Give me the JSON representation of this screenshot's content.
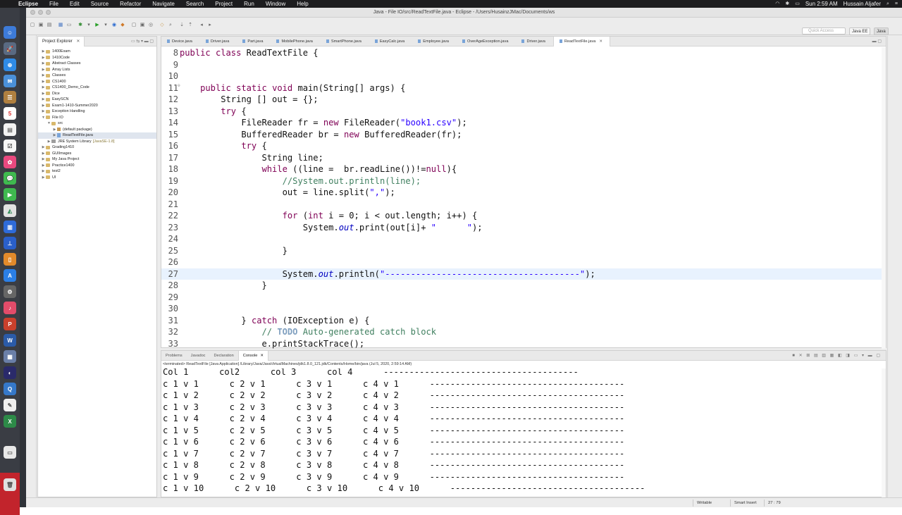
{
  "menubar": {
    "app": "Eclipse",
    "items": [
      "File",
      "Edit",
      "Source",
      "Refactor",
      "Navigate",
      "Search",
      "Project",
      "Run",
      "Window",
      "Help"
    ],
    "clock": "Sun 2:59 AM",
    "user": "Hussain Aljafer"
  },
  "window": {
    "title": "Java - File IO/src/ReadTextFile.java - Eclipse - /Users/HusainzJMac/Documents/ws",
    "quick_access": "Quick Access",
    "perspectives": [
      "Java EE",
      "Java"
    ]
  },
  "explorer": {
    "tab": "Project Explorer",
    "items": [
      {
        "label": "1400Exam",
        "depth": 0,
        "arrow": "▶",
        "kind": "folder"
      },
      {
        "label": "1410Code",
        "depth": 0,
        "arrow": "▶",
        "kind": "folder"
      },
      {
        "label": "Abstract Classes",
        "depth": 0,
        "arrow": "▶",
        "kind": "folder"
      },
      {
        "label": "Array Lists",
        "depth": 0,
        "arrow": "▶",
        "kind": "folder"
      },
      {
        "label": "Classes",
        "depth": 0,
        "arrow": "▶",
        "kind": "folder"
      },
      {
        "label": "CS1400",
        "depth": 0,
        "arrow": "▶",
        "kind": "folder"
      },
      {
        "label": "CS1400_Demo_Code",
        "depth": 0,
        "arrow": "▶",
        "kind": "folder"
      },
      {
        "label": "Dice",
        "depth": 0,
        "arrow": "▶",
        "kind": "folder"
      },
      {
        "label": "EasySCN",
        "depth": 0,
        "arrow": "▶",
        "kind": "folder"
      },
      {
        "label": "Exam1-1410-Summer2020",
        "depth": 0,
        "arrow": "▶",
        "kind": "folder"
      },
      {
        "label": "Exception Handling",
        "depth": 0,
        "arrow": "▶",
        "kind": "folder"
      },
      {
        "label": "File IO",
        "depth": 0,
        "arrow": "▼",
        "kind": "folder"
      },
      {
        "label": "src",
        "depth": 1,
        "arrow": "▼",
        "kind": "folder"
      },
      {
        "label": "(default package)",
        "depth": 2,
        "arrow": "▶",
        "kind": "package"
      },
      {
        "label": "ReadTextFile.java",
        "depth": 2,
        "arrow": "▶",
        "kind": "file",
        "selected": true
      },
      {
        "label": "JRE System Library",
        "depth": 1,
        "arrow": "▶",
        "kind": "library",
        "suffix": "[JavaSE-1.8]"
      },
      {
        "label": "Grading1410",
        "depth": 0,
        "arrow": "▶",
        "kind": "folder"
      },
      {
        "label": "GUIImages",
        "depth": 0,
        "arrow": "▶",
        "kind": "folder"
      },
      {
        "label": "My Java Project",
        "depth": 0,
        "arrow": "▶",
        "kind": "folder"
      },
      {
        "label": "Practice1400",
        "depth": 0,
        "arrow": "▶",
        "kind": "folder"
      },
      {
        "label": "test2",
        "depth": 0,
        "arrow": "▶",
        "kind": "folder"
      },
      {
        "label": "UI",
        "depth": 0,
        "arrow": "▶",
        "kind": "folder"
      }
    ]
  },
  "editor": {
    "tabs": [
      "Device.java",
      "Driver.java",
      "Part.java",
      "MobilePhone.java",
      "SmartPhone.java",
      "EasyCalc.java",
      "Employee.java",
      "OverAgeException.java",
      "Driver.java",
      "ReadTextFile.java"
    ],
    "active_tab": 9,
    "lines": [
      {
        "num": "8",
        "text": "public class ReadTextFile {"
      },
      {
        "num": "9",
        "text": ""
      },
      {
        "num": "10",
        "text": ""
      },
      {
        "num": "11",
        "text": "    public static void main(String[] args) {",
        "fold": true
      },
      {
        "num": "12",
        "text": "        String [] out = {};"
      },
      {
        "num": "13",
        "text": "        try {"
      },
      {
        "num": "14",
        "text": "            FileReader fr = new FileReader(\"book1.csv\");"
      },
      {
        "num": "15",
        "text": "            BufferedReader br = new BufferedReader(fr);"
      },
      {
        "num": "16",
        "text": "            try {"
      },
      {
        "num": "17",
        "text": "                String line;"
      },
      {
        "num": "18",
        "text": "                while ((line =  br.readLine())!=null){"
      },
      {
        "num": "19",
        "text": "                    //System.out.println(line);"
      },
      {
        "num": "20",
        "text": "                    out = line.split(\",\");"
      },
      {
        "num": "21",
        "text": ""
      },
      {
        "num": "22",
        "text": "                    for (int i = 0; i < out.length; i++) {"
      },
      {
        "num": "23",
        "text": "                        System.out.print(out[i]+ \"      \");"
      },
      {
        "num": "24",
        "text": ""
      },
      {
        "num": "25",
        "text": "                    }"
      },
      {
        "num": "26",
        "text": ""
      },
      {
        "num": "27",
        "text": "                    System.out.println(\"--------------------------------------\");",
        "current": true
      },
      {
        "num": "28",
        "text": "                }"
      },
      {
        "num": "29",
        "text": ""
      },
      {
        "num": "30",
        "text": ""
      },
      {
        "num": "31",
        "text": "            } catch (IOException e) {"
      },
      {
        "num": "32",
        "text": "                // TODO Auto-generated catch block"
      },
      {
        "num": "33",
        "text": "                e.printStackTrace();"
      }
    ]
  },
  "console": {
    "tabs": [
      "Problems",
      "Javadoc",
      "Declaration",
      "Console"
    ],
    "active_tab": 3,
    "title": "<terminated> ReadTextFile [Java Application] /Library/Java/JavaVirtualMachines/jdk1.8.0_121.jdk/Contents/Home/bin/java (Jul 5, 2020, 2:59:14 AM)",
    "lines": [
      "Col 1      col2      col 3      col 4      --------------------------------------",
      "c 1 v 1      c 2 v 1      c 3 v 1      c 4 v 1      --------------------------------------",
      "c 1 v 2      c 2 v 2      c 3 v 2      c 4 v 2      --------------------------------------",
      "c 1 v 3      c 2 v 3      c 3 v 3      c 4 v 3      --------------------------------------",
      "c 1 v 4      c 2 v 4      c 3 v 4      c 4 v 4      --------------------------------------",
      "c 1 v 5      c 2 v 5      c 3 v 5      c 4 v 5      --------------------------------------",
      "c 1 v 6      c 2 v 6      c 3 v 6      c 4 v 6      --------------------------------------",
      "c 1 v 7      c 2 v 7      c 3 v 7      c 4 v 7      --------------------------------------",
      "c 1 v 8      c 2 v 8      c 3 v 8      c 4 v 8      --------------------------------------",
      "c 1 v 9      c 2 v 9      c 3 v 9      c 4 v 9      --------------------------------------",
      "c 1 v 10      c 2 v 10      c 3 v 10      c 4 v 10      --------------------------------------"
    ]
  },
  "statusbar": {
    "writable": "Writable",
    "insert_mode": "Smart Insert",
    "position": "27 : 79"
  },
  "colors": {
    "keyword": "#7f0055",
    "string": "#2a00ff",
    "comment": "#3f7f5f",
    "field": "#0000c0",
    "current_line": "#e8f2fe"
  }
}
